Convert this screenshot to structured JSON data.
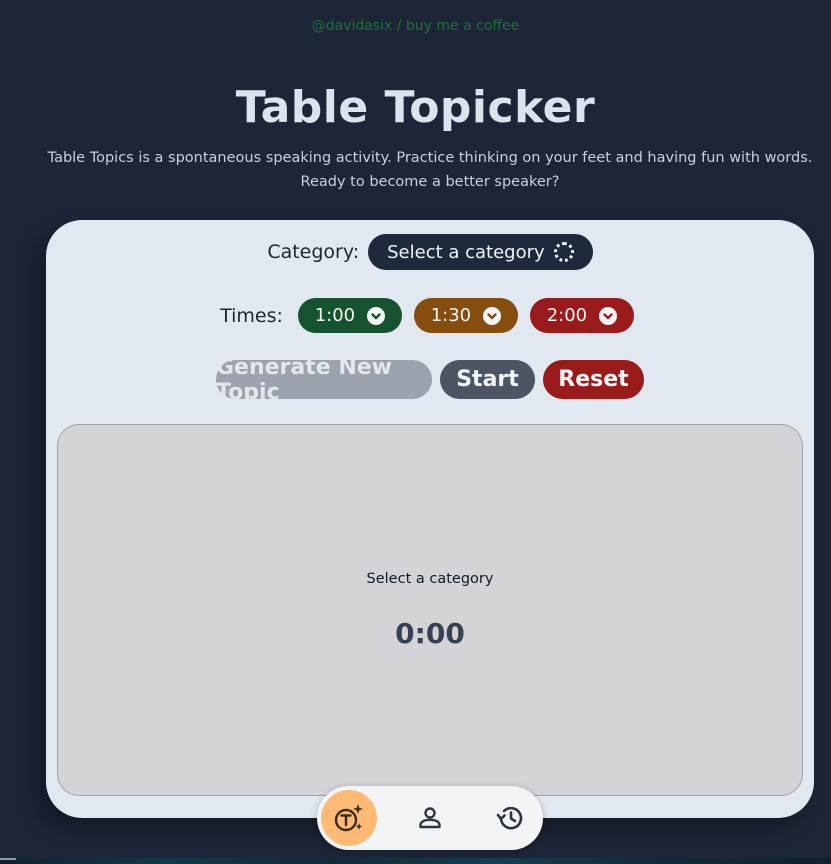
{
  "credit": {
    "author": "@davidasix",
    "separator": " / ",
    "coffee": "buy me a coffee"
  },
  "header": {
    "title": "Table Topicker",
    "subtitle_line1": "Table Topics is a spontaneous speaking activity. Practice thinking on your feet and having fun with words.",
    "subtitle_line2": "Ready to become a better speaker?"
  },
  "controls": {
    "category_label": "Category:",
    "category_placeholder": "Select a category",
    "times_label": "Times:",
    "times": [
      {
        "label": "1:00",
        "color": "#14532d"
      },
      {
        "label": "1:30",
        "color": "#854d0e"
      },
      {
        "label": "2:00",
        "color": "#991b1b"
      }
    ],
    "generate_label": "Generate New Topic",
    "start_label": "Start",
    "reset_label": "Reset"
  },
  "display": {
    "topic": "Select a category",
    "timer": "0:00"
  },
  "nav": {
    "items": [
      {
        "icon": "topic-sparkle-icon",
        "active": true
      },
      {
        "icon": "person-icon",
        "active": false
      },
      {
        "icon": "history-icon",
        "active": false
      }
    ]
  },
  "colors": {
    "background": "#1d2637",
    "card": "#e2e8f0",
    "accent_active": "#fdba74",
    "credit_link": "#1f6f3a"
  }
}
